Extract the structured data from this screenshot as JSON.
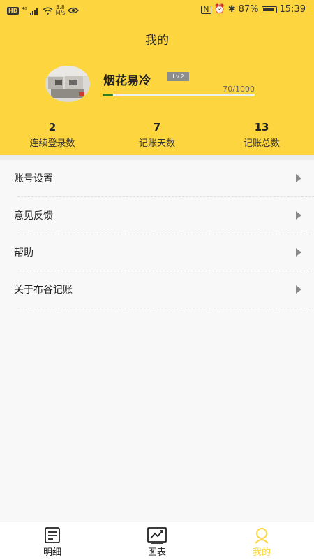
{
  "status_bar": {
    "hd": "HD",
    "signal": "⁴⁶",
    "net_speed": "3.8",
    "net_unit": "M/s",
    "battery": "87%",
    "time": "15:39"
  },
  "header": {
    "title": "我的",
    "username": "烟花易冷",
    "level": "Lv.2",
    "xp_text": "70/1000",
    "xp_fraction": 0.07
  },
  "stats": [
    {
      "value": "2",
      "label": "连续登录数"
    },
    {
      "value": "7",
      "label": "记账天数"
    },
    {
      "value": "13",
      "label": "记账总数"
    }
  ],
  "menu": [
    {
      "label": "账号设置"
    },
    {
      "label": "意见反馈"
    },
    {
      "label": "帮助"
    },
    {
      "label": "关于布谷记账"
    }
  ],
  "tabs": [
    {
      "label": "明细",
      "icon": "list-icon"
    },
    {
      "label": "图表",
      "icon": "chart-icon"
    },
    {
      "label": "我的",
      "icon": "profile-icon",
      "active": true
    }
  ],
  "colors": {
    "accent": "#fdd63f",
    "xp_fill": "#2e7d1d"
  }
}
